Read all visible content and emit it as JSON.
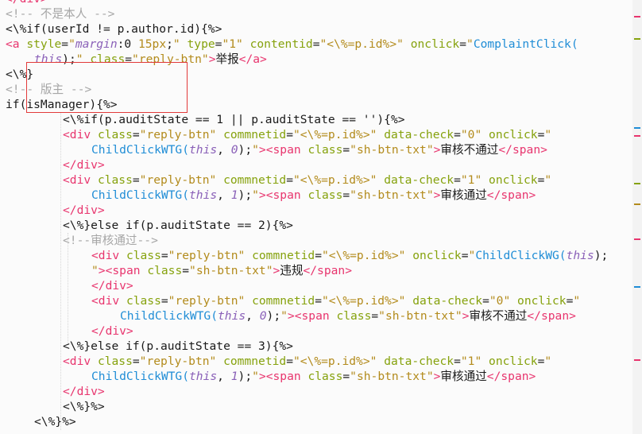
{
  "editor": {
    "highlight_color": "#e23a3a",
    "colors": {
      "tag": "#e8356e",
      "attribute": "#86a20d",
      "string": "#b38b1c",
      "function": "#1f8dd6",
      "keyword": "#8a60b8",
      "comment": "#a6a6a6",
      "plain": "#1a1a1a"
    }
  },
  "lines": [
    {
      "indent": 1,
      "tokens": [
        [
          "tag",
          "</div>"
        ]
      ]
    },
    {
      "indent": 1,
      "tokens": [
        [
          "cmt",
          "<!-- 不是本人 -->"
        ]
      ]
    },
    {
      "indent": 1,
      "tokens": [
        [
          "pl",
          "<\\%if(userId != p.author.id){%>"
        ]
      ]
    },
    {
      "indent": 1,
      "tokens": [
        [
          "tag",
          "<a "
        ],
        [
          "attr",
          "style"
        ],
        [
          "pl",
          "="
        ],
        [
          "str",
          "\""
        ],
        [
          "kw",
          "margin"
        ],
        [
          "pl",
          ":0 "
        ],
        [
          "str",
          "15px"
        ],
        [
          "pl",
          ";"
        ],
        [
          "str",
          "\" "
        ],
        [
          "attr",
          "type"
        ],
        [
          "pl",
          "="
        ],
        [
          "str",
          "\"1\" "
        ],
        [
          "attr",
          "contentid"
        ],
        [
          "pl",
          "="
        ],
        [
          "str",
          "\"<\\%=p.id%>\" "
        ],
        [
          "attr",
          "onclick"
        ],
        [
          "pl",
          "="
        ],
        [
          "str",
          "\""
        ],
        [
          "fn",
          "ComplaintClick("
        ]
      ]
    },
    {
      "indent": 2,
      "tokens": [
        [
          "kw",
          "this"
        ],
        [
          "pl",
          ");"
        ],
        [
          "str",
          "\" "
        ],
        [
          "attr",
          "class"
        ],
        [
          "pl",
          "="
        ],
        [
          "str",
          "\"reply-btn\""
        ],
        [
          "tag",
          ">"
        ],
        [
          "pl",
          "举报"
        ],
        [
          "tag",
          "</a>"
        ]
      ]
    },
    {
      "indent": 1,
      "tokens": [
        [
          "pl",
          "<\\%}"
        ]
      ]
    },
    {
      "indent": 1,
      "tokens": [
        [
          "cmt",
          "<!-- 版主 -->"
        ]
      ]
    },
    {
      "indent": 1,
      "tokens": [
        [
          "pl",
          "if(isManager){%>"
        ]
      ]
    },
    {
      "indent": 3,
      "tokens": [
        [
          "pl",
          "<\\%if(p.auditState == 1 || p.auditState == ''){%>"
        ]
      ]
    },
    {
      "indent": 3,
      "tokens": [
        [
          "tag",
          "<div "
        ],
        [
          "attr",
          "class"
        ],
        [
          "pl",
          "="
        ],
        [
          "str",
          "\"reply-btn\" "
        ],
        [
          "attr",
          "commnetid"
        ],
        [
          "pl",
          "="
        ],
        [
          "str",
          "\"<\\%=p.id%>\" "
        ],
        [
          "attr",
          "data-check"
        ],
        [
          "pl",
          "="
        ],
        [
          "str",
          "\"0\" "
        ],
        [
          "attr",
          "onclick"
        ],
        [
          "pl",
          "="
        ],
        [
          "str",
          "\""
        ]
      ]
    },
    {
      "indent": 4,
      "tokens": [
        [
          "fn",
          "ChildClickWTG("
        ],
        [
          "kw",
          "this"
        ],
        [
          "pl",
          ", "
        ],
        [
          "kw",
          "0"
        ],
        [
          "pl",
          ");"
        ],
        [
          "str",
          "\""
        ],
        [
          "tag",
          "><span "
        ],
        [
          "attr",
          "class"
        ],
        [
          "pl",
          "="
        ],
        [
          "str",
          "\"sh-btn-txt\""
        ],
        [
          "tag",
          ">"
        ],
        [
          "pl",
          "审核不通过"
        ],
        [
          "tag",
          "</span>"
        ]
      ]
    },
    {
      "indent": 3,
      "tokens": [
        [
          "tag",
          "</div>"
        ]
      ]
    },
    {
      "indent": 3,
      "tokens": [
        [
          "tag",
          "<div "
        ],
        [
          "attr",
          "class"
        ],
        [
          "pl",
          "="
        ],
        [
          "str",
          "\"reply-btn\" "
        ],
        [
          "attr",
          "commnetid"
        ],
        [
          "pl",
          "="
        ],
        [
          "str",
          "\"<\\%=p.id%>\" "
        ],
        [
          "attr",
          "data-check"
        ],
        [
          "pl",
          "="
        ],
        [
          "str",
          "\"1\" "
        ],
        [
          "attr",
          "onclick"
        ],
        [
          "pl",
          "="
        ],
        [
          "str",
          "\""
        ]
      ]
    },
    {
      "indent": 4,
      "tokens": [
        [
          "fn",
          "ChildClickWTG("
        ],
        [
          "kw",
          "this"
        ],
        [
          "pl",
          ", "
        ],
        [
          "kw",
          "1"
        ],
        [
          "pl",
          ");"
        ],
        [
          "str",
          "\""
        ],
        [
          "tag",
          "><span "
        ],
        [
          "attr",
          "class"
        ],
        [
          "pl",
          "="
        ],
        [
          "str",
          "\"sh-btn-txt\""
        ],
        [
          "tag",
          ">"
        ],
        [
          "pl",
          "审核通过"
        ],
        [
          "tag",
          "</span>"
        ]
      ]
    },
    {
      "indent": 3,
      "tokens": [
        [
          "tag",
          "</div>"
        ]
      ]
    },
    {
      "indent": 3,
      "tokens": [
        [
          "pl",
          "<\\%}else if(p.auditState == 2){%>"
        ]
      ]
    },
    {
      "indent": 3,
      "tokens": [
        [
          "cmt",
          "<!--审核通过-->"
        ]
      ]
    },
    {
      "indent": 4,
      "tokens": [
        [
          "tag",
          "<div "
        ],
        [
          "attr",
          "class"
        ],
        [
          "pl",
          "="
        ],
        [
          "str",
          "\"reply-btn\" "
        ],
        [
          "attr",
          "commnetid"
        ],
        [
          "pl",
          "="
        ],
        [
          "str",
          "\"<\\%=p.id%>\" "
        ],
        [
          "attr",
          "onclick"
        ],
        [
          "pl",
          "="
        ],
        [
          "str",
          "\""
        ],
        [
          "fn",
          "ChildClickWG("
        ],
        [
          "kw",
          "this"
        ],
        [
          "pl",
          ");"
        ]
      ]
    },
    {
      "indent": 4,
      "tokens": [
        [
          "str",
          "\""
        ],
        [
          "tag",
          "><span "
        ],
        [
          "attr",
          "class"
        ],
        [
          "pl",
          "="
        ],
        [
          "str",
          "\"sh-btn-txt\""
        ],
        [
          "tag",
          ">"
        ],
        [
          "pl",
          "违规"
        ],
        [
          "tag",
          "</span>"
        ]
      ]
    },
    {
      "indent": 4,
      "tokens": [
        [
          "tag",
          "</div>"
        ]
      ]
    },
    {
      "indent": 4,
      "tokens": [
        [
          "tag",
          "<div "
        ],
        [
          "attr",
          "class"
        ],
        [
          "pl",
          "="
        ],
        [
          "str",
          "\"reply-btn\" "
        ],
        [
          "attr",
          "commnetid"
        ],
        [
          "pl",
          "="
        ],
        [
          "str",
          "\"<\\%=p.id%>\" "
        ],
        [
          "attr",
          "data-check"
        ],
        [
          "pl",
          "="
        ],
        [
          "str",
          "\"0\" "
        ],
        [
          "attr",
          "onclick"
        ],
        [
          "pl",
          "="
        ],
        [
          "str",
          "\""
        ]
      ]
    },
    {
      "indent": 5,
      "tokens": [
        [
          "fn",
          "ChildClickWTG("
        ],
        [
          "kw",
          "this"
        ],
        [
          "pl",
          ", "
        ],
        [
          "kw",
          "0"
        ],
        [
          "pl",
          ");"
        ],
        [
          "str",
          "\""
        ],
        [
          "tag",
          "><span "
        ],
        [
          "attr",
          "class"
        ],
        [
          "pl",
          "="
        ],
        [
          "str",
          "\"sh-btn-txt\""
        ],
        [
          "tag",
          ">"
        ],
        [
          "pl",
          "审核不通过"
        ],
        [
          "tag",
          "</span>"
        ]
      ]
    },
    {
      "indent": 4,
      "tokens": [
        [
          "tag",
          "</div>"
        ]
      ]
    },
    {
      "indent": 3,
      "tokens": [
        [
          "pl",
          "<\\%}else if(p.auditState == 3){%>"
        ]
      ]
    },
    {
      "indent": 3,
      "tokens": [
        [
          "tag",
          "<div "
        ],
        [
          "attr",
          "class"
        ],
        [
          "pl",
          "="
        ],
        [
          "str",
          "\"reply-btn\" "
        ],
        [
          "attr",
          "commnetid"
        ],
        [
          "pl",
          "="
        ],
        [
          "str",
          "\"<\\%=p.id%>\" "
        ],
        [
          "attr",
          "data-check"
        ],
        [
          "pl",
          "="
        ],
        [
          "str",
          "\"1\" "
        ],
        [
          "attr",
          "onclick"
        ],
        [
          "pl",
          "="
        ],
        [
          "str",
          "\""
        ]
      ]
    },
    {
      "indent": 4,
      "tokens": [
        [
          "fn",
          "ChildClickWTG("
        ],
        [
          "kw",
          "this"
        ],
        [
          "pl",
          ", "
        ],
        [
          "kw",
          "1"
        ],
        [
          "pl",
          ");"
        ],
        [
          "str",
          "\""
        ],
        [
          "tag",
          "><span "
        ],
        [
          "attr",
          "class"
        ],
        [
          "pl",
          "="
        ],
        [
          "str",
          "\"sh-btn-txt\""
        ],
        [
          "tag",
          ">"
        ],
        [
          "pl",
          "审核通过"
        ],
        [
          "tag",
          "</span>"
        ]
      ]
    },
    {
      "indent": 3,
      "tokens": [
        [
          "tag",
          "</div>"
        ]
      ]
    },
    {
      "indent": 3,
      "tokens": [
        [
          "pl",
          "<\\%}%>"
        ]
      ]
    },
    {
      "indent": 2,
      "tokens": [
        [
          "pl",
          "<\\%}%>"
        ]
      ]
    }
  ]
}
